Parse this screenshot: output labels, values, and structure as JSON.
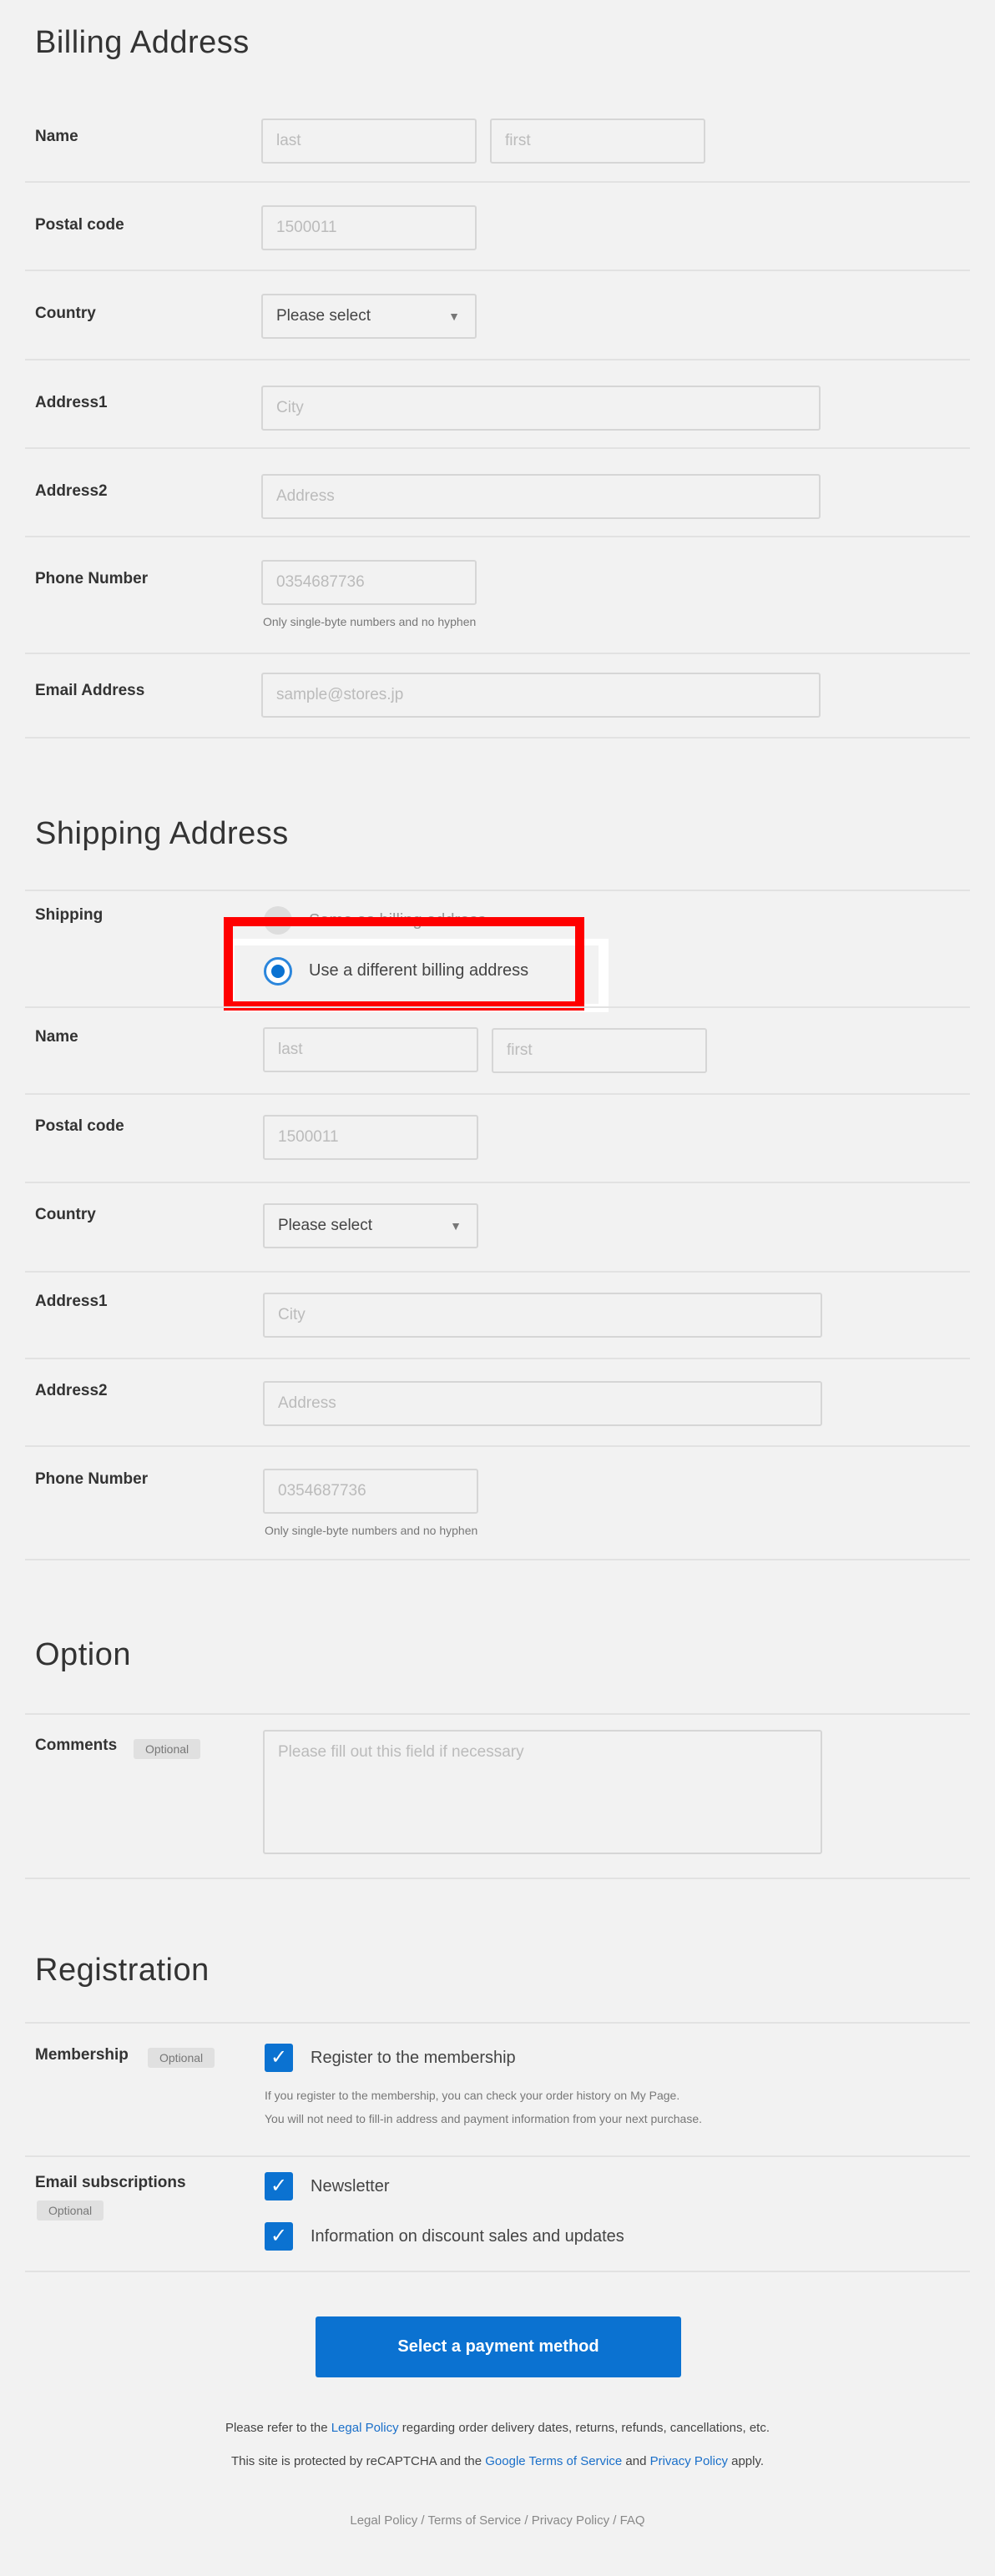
{
  "billing": {
    "title": "Billing Address",
    "name_label": "Name",
    "last_placeholder": "last",
    "first_placeholder": "first",
    "postal_label": "Postal code",
    "postal_placeholder": "1500011",
    "country_label": "Country",
    "country_value": "Please select",
    "address1_label": "Address1",
    "address1_placeholder": "City",
    "address2_label": "Address2",
    "address2_placeholder": "Address",
    "phone_label": "Phone Number",
    "phone_placeholder": "0354687736",
    "phone_hint": "Only single-byte numbers and no hyphen",
    "email_label": "Email Address",
    "email_placeholder": "sample@stores.jp"
  },
  "shipping": {
    "title": "Shipping Address",
    "shipping_label": "Shipping",
    "option_same": "Same as billing address",
    "option_different": "Use a different billing address",
    "selected": "different",
    "name_label": "Name",
    "last_placeholder": "last",
    "first_placeholder": "first",
    "postal_label": "Postal code",
    "postal_placeholder": "1500011",
    "country_label": "Country",
    "country_value": "Please select",
    "address1_label": "Address1",
    "address1_placeholder": "City",
    "address2_label": "Address2",
    "address2_placeholder": "Address",
    "phone_label": "Phone Number",
    "phone_placeholder": "0354687736",
    "phone_hint": "Only single-byte numbers and no hyphen"
  },
  "option": {
    "title": "Option",
    "comments_label": "Comments",
    "optional_badge": "Optional",
    "comments_placeholder": "Please fill out this field if necessary"
  },
  "registration": {
    "title": "Registration",
    "membership_label": "Membership",
    "optional_badge": "Optional",
    "membership_checkbox": "Register to the membership",
    "membership_checked": true,
    "membership_hint1": "If you register to the membership, you can check your order history on My Page.",
    "membership_hint2": "You will not need to fill-in address and payment information from your next purchase.",
    "email_label": "Email subscriptions",
    "email_optional_badge": "Optional",
    "newsletter": "Newsletter",
    "newsletter_checked": true,
    "discount_info": "Information on discount sales and updates",
    "discount_checked": true
  },
  "submit_label": "Select a payment method",
  "notes": {
    "line1_pre": "Please refer to the ",
    "line1_link": "Legal Policy",
    "line1_post": " regarding order delivery dates, returns, refunds, cancellations, etc.",
    "line2_pre": "This site is protected by reCAPTCHA and the ",
    "line2_link1": "Google Terms of Service",
    "line2_mid": " and ",
    "line2_link2": "Privacy Policy",
    "line2_post": " apply."
  },
  "footer": {
    "legal": "Legal Policy",
    "terms": "Terms of Service",
    "privacy": "Privacy Policy",
    "faq": "FAQ",
    "sep": " / "
  },
  "colors": {
    "accent": "#0b72d1",
    "highlight": "#ff0000",
    "background": "#f2f2f2"
  },
  "icons": {
    "select_arrow": "triangle-down",
    "checkbox": "check",
    "radio": "radio"
  }
}
